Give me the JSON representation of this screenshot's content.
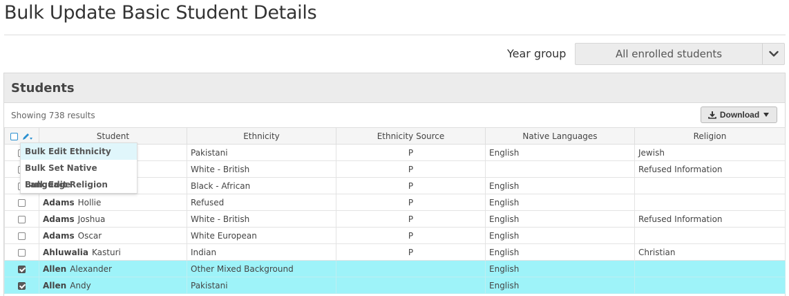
{
  "page": {
    "title": "Bulk Update Basic Student Details"
  },
  "filter": {
    "label": "Year group",
    "value": "All enrolled students"
  },
  "panel": {
    "title": "Students",
    "showing": "Showing 738 results",
    "download_label": "Download"
  },
  "table": {
    "columns": [
      "Student",
      "Ethnicity",
      "Ethnicity Source",
      "Native Languages",
      "Religion"
    ],
    "rows": [
      {
        "last": "",
        "first": "",
        "ethnicity": "Pakistani",
        "source": "P",
        "language": "English",
        "religion": "Jewish",
        "checked": false
      },
      {
        "last": "",
        "first": "",
        "ethnicity": "White - British",
        "source": "P",
        "language": "",
        "religion": "Refused Information",
        "checked": false
      },
      {
        "last": "",
        "first": "",
        "ethnicity": "Black - African",
        "source": "P",
        "language": "English",
        "religion": "",
        "checked": false
      },
      {
        "last": "Adams",
        "first": "Hollie",
        "ethnicity": "Refused",
        "source": "P",
        "language": "English",
        "religion": "",
        "checked": false
      },
      {
        "last": "Adams",
        "first": "Joshua",
        "ethnicity": "White - British",
        "source": "P",
        "language": "English",
        "religion": "Refused Information",
        "checked": false
      },
      {
        "last": "Adams",
        "first": "Oscar",
        "ethnicity": "White European",
        "source": "P",
        "language": "English",
        "religion": "",
        "checked": false
      },
      {
        "last": "Ahluwalia",
        "first": "Kasturi",
        "ethnicity": "Indian",
        "source": "P",
        "language": "English",
        "religion": "Christian",
        "checked": false
      },
      {
        "last": "Allen",
        "first": "Alexander",
        "ethnicity": "Other Mixed Background",
        "source": "",
        "language": "English",
        "religion": "",
        "checked": true
      },
      {
        "last": "Allen",
        "first": "Andy",
        "ethnicity": "Pakistani",
        "source": "",
        "language": "English",
        "religion": "",
        "checked": true
      }
    ]
  },
  "bulk_menu": {
    "items": [
      "Bulk Edit Ethnicity",
      "Bulk Set Native Language",
      "Bulk Edit Religion"
    ],
    "active_index": 0
  },
  "icons": {
    "filter_toggle": "chevron-down-icon",
    "download": "download-icon",
    "download_caret": "caret-down-icon",
    "bulk_edit": "pencil-icon"
  },
  "colors": {
    "selected_row": "#9ef3f9",
    "accent": "#2a8fd0",
    "panel_header": "#ececec"
  }
}
